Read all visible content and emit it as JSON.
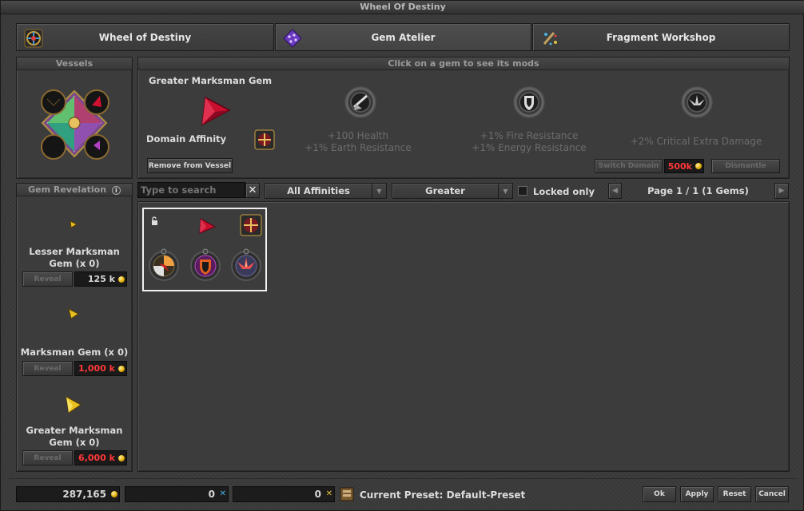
{
  "window": {
    "title": "Wheel Of Destiny"
  },
  "tabs": [
    {
      "label": "Wheel of Destiny",
      "icon": "wheel-icon"
    },
    {
      "label": "Gem Atelier",
      "icon": "gem-atelier-icon",
      "active": true
    },
    {
      "label": "Fragment Workshop",
      "icon": "fragment-workshop-icon"
    }
  ],
  "vessels": {
    "header": "Vessels"
  },
  "gem_detail": {
    "header": "Click on a gem to see its mods",
    "gem_name": "Greater Marksman Gem",
    "domain_label": "Domain Affinity",
    "remove_button": "Remove from Vessel",
    "mods": [
      {
        "line1": "+100 Health",
        "line2": "+1% Earth Resistance"
      },
      {
        "line1": "+1% Fire Resistance",
        "line2": "+1% Energy Resistance"
      },
      {
        "line1": "+2% Critical Extra Damage",
        "line2": ""
      }
    ],
    "switch_domain_button": "Switch Domain",
    "switch_domain_price": "500k",
    "dismantle_button": "Dismantle"
  },
  "revelation": {
    "header": "Gem Revelation",
    "gems": [
      {
        "name_line1": "Lesser Marksman",
        "name_line2": "Gem (x 0)",
        "button": "Reveal",
        "price": "125 k"
      },
      {
        "name_line1": "Marksman Gem (x 0)",
        "name_line2": "",
        "button": "Reveal",
        "price": "1,000 k"
      },
      {
        "name_line1": "Greater Marksman",
        "name_line2": "Gem (x 0)",
        "button": "Reveal",
        "price": "6,000 k"
      }
    ]
  },
  "filters": {
    "search_placeholder": "Type to search",
    "affinity": "All Affinities",
    "quality": "Greater",
    "locked_only": "Locked only",
    "page_info": "Page 1 / 1 (1 Gems)"
  },
  "footer": {
    "gold": "287,165",
    "lesser_fragments": "0",
    "greater_fragments": "0",
    "preset": "Current Preset: Default-Preset",
    "ok": "Ok",
    "apply": "Apply",
    "reset": "Reset",
    "cancel": "Cancel"
  },
  "colors": {
    "price_red": "#ff3838",
    "gem_red": "#c8102e",
    "gem_yellow": "#e8c020"
  }
}
